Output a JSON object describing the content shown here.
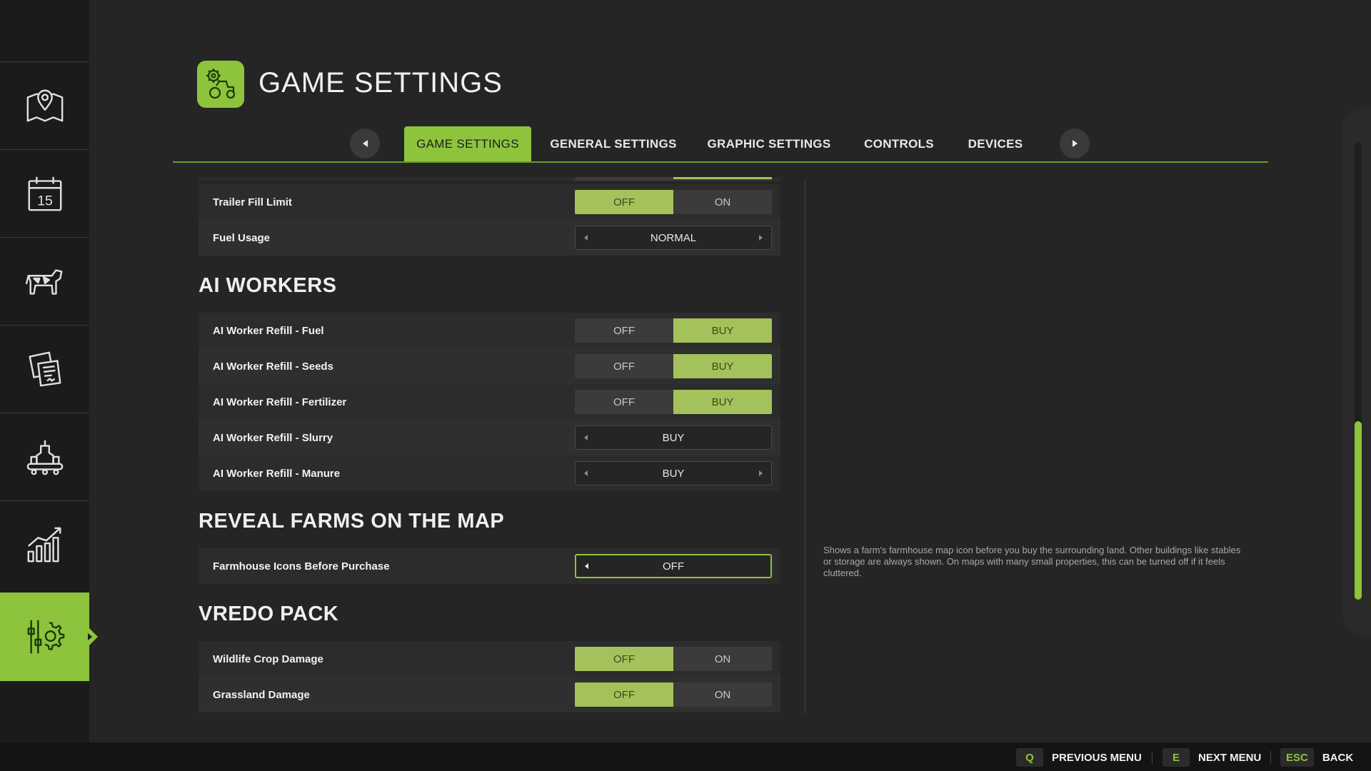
{
  "header": {
    "title": "GAME SETTINGS"
  },
  "sidebar": {
    "items": [
      {
        "icon": "map-icon"
      },
      {
        "icon": "calendar-icon",
        "day": "15"
      },
      {
        "icon": "cow-icon"
      },
      {
        "icon": "contracts-icon"
      },
      {
        "icon": "production-icon"
      },
      {
        "icon": "statistics-icon"
      },
      {
        "icon": "settings-icon",
        "active": true
      }
    ]
  },
  "tabs": [
    {
      "label": "GAME SETTINGS",
      "active": true
    },
    {
      "label": "GENERAL SETTINGS"
    },
    {
      "label": "GRAPHIC SETTINGS"
    },
    {
      "label": "CONTROLS"
    },
    {
      "label": "DEVICES"
    }
  ],
  "settings": {
    "trailer_fill_limit": {
      "label": "Trailer Fill Limit",
      "off": "OFF",
      "on": "ON",
      "value": "OFF"
    },
    "fuel_usage": {
      "label": "Fuel Usage",
      "value": "NORMAL"
    },
    "ai_workers": {
      "title": "AI WORKERS",
      "fuel": {
        "label": "AI Worker Refill - Fuel",
        "off": "OFF",
        "on": "BUY",
        "value": "BUY"
      },
      "seeds": {
        "label": "AI Worker Refill - Seeds",
        "off": "OFF",
        "on": "BUY",
        "value": "BUY"
      },
      "fertilizer": {
        "label": "AI Worker Refill - Fertilizer",
        "off": "OFF",
        "on": "BUY",
        "value": "BUY"
      },
      "slurry": {
        "label": "AI Worker Refill - Slurry",
        "value": "BUY"
      },
      "manure": {
        "label": "AI Worker Refill - Manure",
        "value": "BUY"
      }
    },
    "reveal_farms": {
      "title": "REVEAL FARMS ON THE MAP",
      "farmhouse_icons": {
        "label": "Farmhouse Icons Before Purchase",
        "value": "OFF"
      }
    },
    "vredo_pack": {
      "title": "VREDO PACK",
      "wildlife": {
        "label": "Wildlife Crop Damage",
        "off": "OFF",
        "on": "ON",
        "value": "OFF"
      },
      "grassland": {
        "label": "Grassland Damage",
        "off": "OFF",
        "on": "ON",
        "value": "OFF"
      }
    }
  },
  "description": "Shows a farm's farmhouse map icon before you buy the surrounding land. Other buildings like stables or storage are always shown. On maps with many small properties, this can be turned off if it feels cluttered.",
  "bottom_hints": [
    {
      "key": "Q",
      "label": "PREVIOUS MENU"
    },
    {
      "key": "E",
      "label": "NEXT MENU"
    },
    {
      "key": "ESC",
      "label": "BACK"
    }
  ],
  "colors": {
    "accent": "#8dc43c",
    "toggle_on": "#a3c25b",
    "background": "#252525",
    "sidebar": "#1b1b1b"
  }
}
